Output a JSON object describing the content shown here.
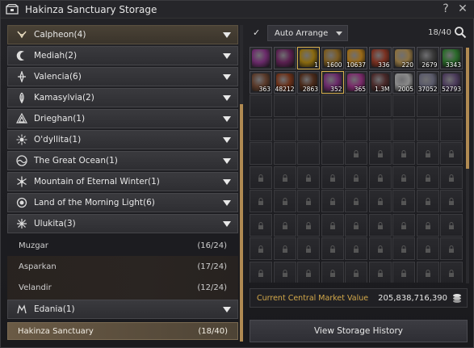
{
  "window": {
    "title": "Hakinza Sanctuary Storage"
  },
  "regions": [
    {
      "label": "Calpheon(4)",
      "icon": "calpheon-icon"
    },
    {
      "label": "Mediah(2)",
      "icon": "mediah-icon"
    },
    {
      "label": "Valencia(6)",
      "icon": "valencia-icon"
    },
    {
      "label": "Kamasylvia(2)",
      "icon": "kamasylvia-icon"
    },
    {
      "label": "Drieghan(1)",
      "icon": "drieghan-icon"
    },
    {
      "label": "O'dyllita(1)",
      "icon": "odyllita-icon"
    },
    {
      "label": "The Great Ocean(1)",
      "icon": "great-ocean-icon"
    },
    {
      "label": "Mountain of Eternal Winter(1)",
      "icon": "eternal-winter-icon"
    },
    {
      "label": "Land of the Morning Light(6)",
      "icon": "morning-light-icon"
    },
    {
      "label": "Ulukita(3)",
      "icon": "ulukita-icon"
    }
  ],
  "ulukita_towns": [
    {
      "name": "Muzgar",
      "count": "(16/24)"
    },
    {
      "name": "Asparkan",
      "count": "(17/24)"
    },
    {
      "name": "Velandir",
      "count": "(12/24)"
    }
  ],
  "edania": {
    "label": "Edania(1)",
    "icon": "edania-icon"
  },
  "current_storage": {
    "name": "Hakinza Sanctuary",
    "count": "(18/40)"
  },
  "toolbar": {
    "auto_arrange": "Auto Arrange",
    "count": "18/40"
  },
  "items": [
    {
      "qty": "",
      "color": "#6a2a6a"
    },
    {
      "qty": "",
      "color": "#5a2050"
    },
    {
      "qty": "1",
      "color": "#8a6a10"
    },
    {
      "qty": "1600",
      "color": "#7a5a20"
    },
    {
      "qty": "10637",
      "color": "#9a6a18"
    },
    {
      "qty": "336",
      "color": "#7a3020"
    },
    {
      "qty": "220",
      "color": "#8a7040"
    },
    {
      "qty": "2679",
      "color": "#3a3a3a"
    },
    {
      "qty": "3343",
      "color": "#2a6a2a"
    },
    {
      "qty": "363",
      "color": "#5a3a2a"
    },
    {
      "qty": "48212",
      "color": "#6a3018"
    },
    {
      "qty": "2863",
      "color": "#4a2a1a"
    },
    {
      "qty": "352",
      "color": "#6a2a6a"
    },
    {
      "qty": "365",
      "color": "#7a2a6a"
    },
    {
      "qty": "1.3M",
      "color": "#4a2a2a"
    },
    {
      "qty": "2005",
      "color": "#8a8a8a"
    },
    {
      "qty": "37052",
      "color": "#5a5a6a"
    },
    {
      "qty": "52793",
      "color": "#4a3a5a"
    }
  ],
  "market": {
    "label": "Current Central Market Value",
    "value": "205,838,716,390"
  },
  "history_button": "View Storage History",
  "colors": {
    "accent_gold": "#d4a94a",
    "scroll_thumb": "#b08a52"
  }
}
